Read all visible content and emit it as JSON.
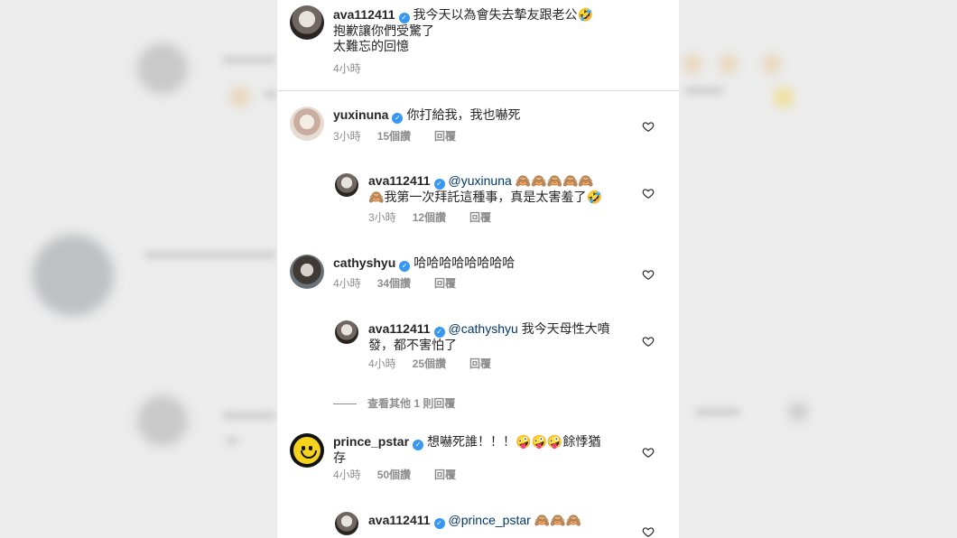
{
  "comments": [
    {
      "username": "ava112411",
      "lines": [
        "我今天以為會失去摯友跟老公",
        "抱歉讓你們受驚了",
        "太難忘的回憶"
      ],
      "emoji": "🤣",
      "time": "4小時"
    },
    {
      "username": "yuxinuna",
      "text": "你打給我，我也嚇死",
      "time": "3小時",
      "likes": "15個讚",
      "reply": "回覆"
    },
    {
      "username": "ava112411",
      "mention": "@yuxinuna",
      "emoji_run": "🙈🙈🙈🙈🙈",
      "line2_emoji": "🙈",
      "line2": "我第一次拜託這種事，真是太害羞了",
      "line2_end": "🤣",
      "time": "3小時",
      "likes": "12個讚",
      "reply": "回覆"
    },
    {
      "username": "cathyshyu",
      "text": "哈哈哈哈哈哈哈哈",
      "time": "4小時",
      "likes": "34個讚",
      "reply": "回覆"
    },
    {
      "username": "ava112411",
      "mention": "@cathyshyu",
      "line1": "我今天母性大噴",
      "line2": "發，都不害怕了",
      "time": "4小時",
      "likes": "25個讚",
      "reply": "回覆"
    },
    {
      "username": "prince_pstar",
      "text": "想嚇死誰！！！",
      "emoji_run": "🤪🤪🤪",
      "text2": "餘悸猶",
      "line2": "存",
      "time": "4小時",
      "likes": "50個讚",
      "reply": "回覆"
    },
    {
      "username": "ava112411",
      "mention": "@prince_pstar",
      "emoji_run": "🙈🙈🙈"
    }
  ],
  "view_more": "查看其他 1 則回覆",
  "colors": {
    "verified": "#3897f0",
    "mention": "#00376b",
    "meta": "#8e8e8e",
    "text": "#262626"
  },
  "icons": {
    "verified": "verified-badge-icon",
    "like": "heart-outline-icon"
  }
}
